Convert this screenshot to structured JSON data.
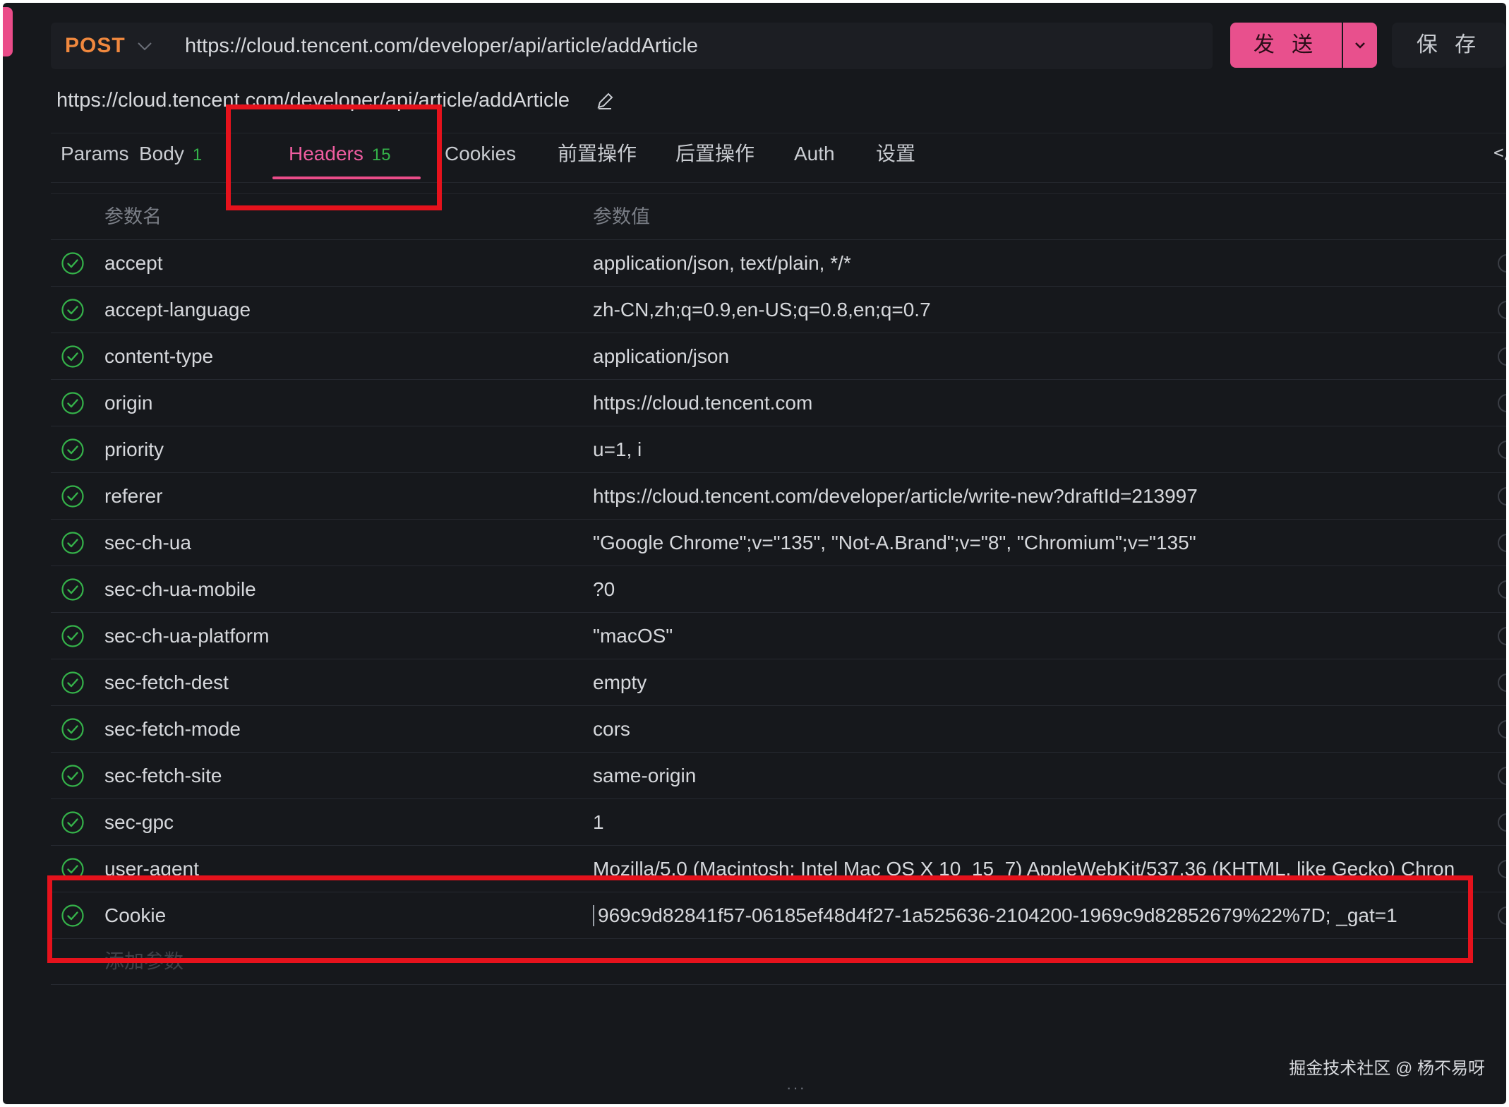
{
  "request": {
    "method": "POST",
    "url": "https://cloud.tencent.com/developer/api/article/addArticle",
    "name": "https://cloud.tencent.com/developer/api/article/addArticle",
    "send_label": "发 送",
    "save_label": "保 存"
  },
  "tabs": [
    {
      "label": "Params",
      "count": ""
    },
    {
      "label": "Body",
      "count": "1"
    },
    {
      "label": "Headers",
      "count": "15",
      "active": true
    },
    {
      "label": "Cookies",
      "count": ""
    },
    {
      "label": "前置操作",
      "count": ""
    },
    {
      "label": "后置操作",
      "count": ""
    },
    {
      "label": "Auth",
      "count": ""
    },
    {
      "label": "设置",
      "count": ""
    }
  ],
  "code_toggle": "</",
  "table": {
    "col_name": "参数名",
    "col_value": "参数值",
    "rows": [
      {
        "name": "accept",
        "value": "application/json, text/plain, */*"
      },
      {
        "name": "accept-language",
        "value": "zh-CN,zh;q=0.9,en-US;q=0.8,en;q=0.7"
      },
      {
        "name": "content-type",
        "value": "application/json"
      },
      {
        "name": "origin",
        "value": "https://cloud.tencent.com"
      },
      {
        "name": "priority",
        "value": "u=1, i"
      },
      {
        "name": "referer",
        "value": "https://cloud.tencent.com/developer/article/write-new?draftId=213997"
      },
      {
        "name": "sec-ch-ua",
        "value": "\"Google Chrome\";v=\"135\", \"Not-A.Brand\";v=\"8\", \"Chromium\";v=\"135\""
      },
      {
        "name": "sec-ch-ua-mobile",
        "value": "?0"
      },
      {
        "name": "sec-ch-ua-platform",
        "value": "\"macOS\""
      },
      {
        "name": "sec-fetch-dest",
        "value": "empty"
      },
      {
        "name": "sec-fetch-mode",
        "value": "cors"
      },
      {
        "name": "sec-fetch-site",
        "value": "same-origin"
      },
      {
        "name": "sec-gpc",
        "value": "1"
      },
      {
        "name": "user-agent",
        "value": "Mozilla/5.0 (Macintosh; Intel Mac OS X 10_15_7) AppleWebKit/537.36 (KHTML, like Gecko) Chron"
      },
      {
        "name": "Cookie",
        "value": "969c9d82841f57-06185ef48d4f27-1a525636-2104200-1969c9d82852679%22%7D; _gat=1"
      }
    ],
    "add_placeholder": "添加参数"
  },
  "footer": {
    "brand": "掘金技术社区 @ 杨不易呀",
    "dots": "···"
  },
  "colors": {
    "accent": "#ea4c89",
    "method": "#f0883e",
    "check": "#35b34a",
    "annotation": "#e5121c",
    "background": "#16181c"
  }
}
